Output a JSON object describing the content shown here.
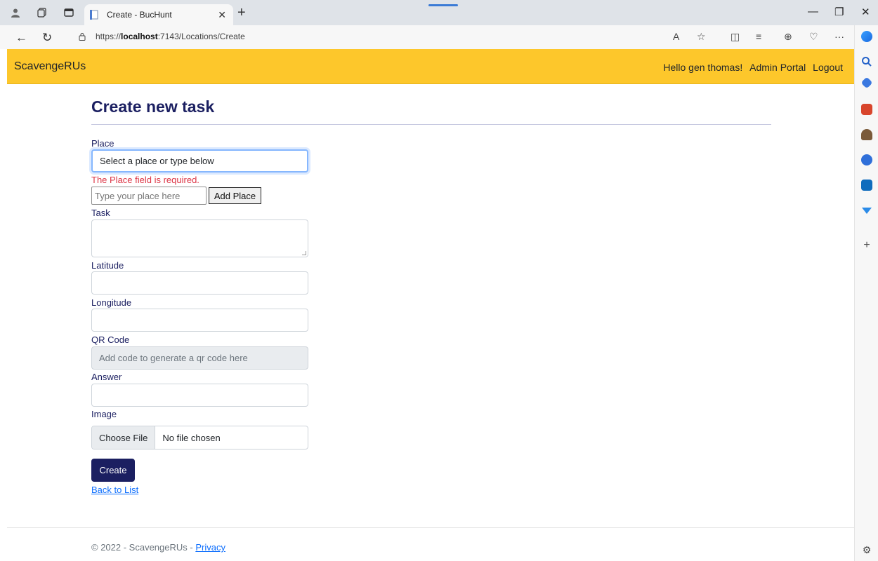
{
  "browser": {
    "tab_title": "Create - BucHunt",
    "url_prefix": "https://",
    "url_host": "localhost",
    "url_rest": ":7143/Locations/Create"
  },
  "navbar": {
    "brand": "ScavengeRUs",
    "greeting": "Hello gen thomas!",
    "admin_portal": "Admin Portal",
    "logout": "Logout"
  },
  "form": {
    "title": "Create new task",
    "place_label": "Place",
    "place_select_value": "Select a place or type below",
    "place_error": "The Place field is required.",
    "place_input_placeholder": "Type your place here",
    "add_place_button": "Add Place",
    "task_label": "Task",
    "latitude_label": "Latitude",
    "longitude_label": "Longitude",
    "qr_label": "QR Code",
    "qr_placeholder": "Add code to generate a qr code here",
    "answer_label": "Answer",
    "image_label": "Image",
    "choose_file": "Choose File",
    "no_file": "No file chosen",
    "create_button": "Create",
    "back_link": "Back to List"
  },
  "footer": {
    "copyright": "© 2022 - ScavengeRUs - ",
    "privacy": "Privacy"
  },
  "colors": {
    "navbar_bg": "#fdc72b",
    "accent": "#1b1f61",
    "error": "#dc3545",
    "link": "#0d6efd"
  }
}
